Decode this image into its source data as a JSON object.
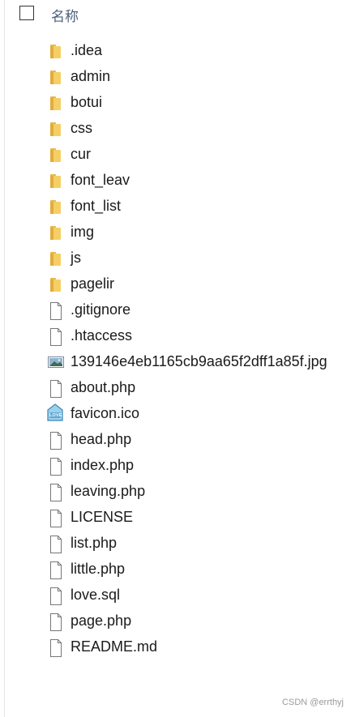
{
  "header": {
    "column_name": "名称",
    "sort_indicator": "^"
  },
  "files": [
    {
      "name": ".idea",
      "icon": "folder-icon"
    },
    {
      "name": "admin",
      "icon": "folder-icon"
    },
    {
      "name": "botui",
      "icon": "folder-icon"
    },
    {
      "name": "css",
      "icon": "folder-icon"
    },
    {
      "name": "cur",
      "icon": "folder-icon"
    },
    {
      "name": "font_leav",
      "icon": "folder-icon"
    },
    {
      "name": "font_list",
      "icon": "folder-icon"
    },
    {
      "name": "img",
      "icon": "folder-icon"
    },
    {
      "name": "js",
      "icon": "folder-icon"
    },
    {
      "name": "pagelir",
      "icon": "folder-icon"
    },
    {
      "name": ".gitignore",
      "icon": "file-icon"
    },
    {
      "name": ".htaccess",
      "icon": "file-icon"
    },
    {
      "name": "139146e4eb1165cb9aa65f2dff1a85f.jpg",
      "icon": "image-file-icon"
    },
    {
      "name": "about.php",
      "icon": "file-icon"
    },
    {
      "name": "favicon.ico",
      "icon": "love-favicon-icon"
    },
    {
      "name": "head.php",
      "icon": "file-icon"
    },
    {
      "name": "index.php",
      "icon": "file-icon"
    },
    {
      "name": "leaving.php",
      "icon": "file-icon"
    },
    {
      "name": "LICENSE",
      "icon": "file-icon"
    },
    {
      "name": "list.php",
      "icon": "file-icon"
    },
    {
      "name": "little.php",
      "icon": "file-icon"
    },
    {
      "name": "love.sql",
      "icon": "file-icon"
    },
    {
      "name": "page.php",
      "icon": "file-icon"
    },
    {
      "name": "README.md",
      "icon": "file-icon"
    }
  ],
  "favicon_text": "LOVE",
  "watermark": "CSDN @errthyj",
  "colors": {
    "folder": "#f5cf66",
    "header_text": "#4c607a"
  }
}
